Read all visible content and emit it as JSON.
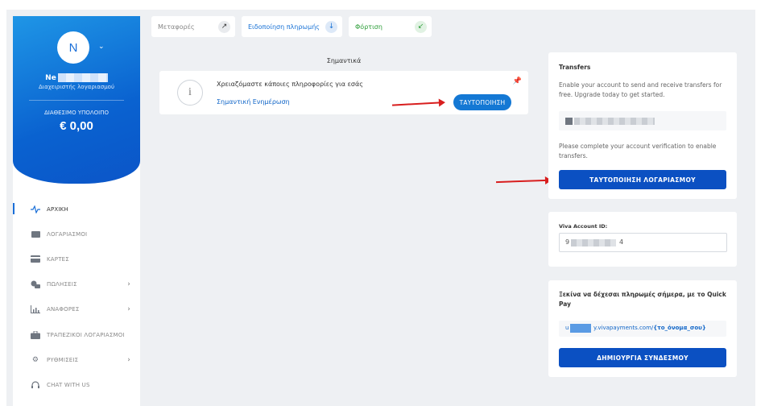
{
  "sidebar": {
    "avatar_initial": "N",
    "user_name": "Ne",
    "user_role": "Διαχειριστής λογαριασμού",
    "balance_label": "ΔΙΑΘΕΣΙΜΟ ΥΠΟΛΟΙΠΟ",
    "balance_value": "€ 0,00",
    "items": [
      {
        "label": "ΑΡΧΙΚΗ",
        "icon": "activity-icon",
        "active": true
      },
      {
        "label": "ΛΟΓΑΡΙΑΣΜΟΙ",
        "icon": "wallet-icon"
      },
      {
        "label": "ΚΑΡΤΕΣ",
        "icon": "card-icon"
      },
      {
        "label": "ΠΩΛΗΣΕΙΣ",
        "icon": "sales-icon",
        "has_submenu": true
      },
      {
        "label": "ΑΝΑΦΟΡΕΣ",
        "icon": "chart-icon",
        "has_submenu": true
      },
      {
        "label": "ΤΡΑΠΕΖΙΚΟΙ ΛΟΓΑΡΙΑΣΜΟΙ",
        "icon": "briefcase-icon"
      },
      {
        "label": "ΡΥΘΜΙΣΕΙΣ",
        "icon": "gear-icon",
        "has_submenu": true
      },
      {
        "label": "CHAT WITH US",
        "icon": "headset-icon"
      }
    ]
  },
  "tabs": [
    {
      "label": "Μεταφορές",
      "icon": "arrow-up-right-icon",
      "color": "#888888"
    },
    {
      "label": "Ειδοποίηση πληρωμής",
      "icon": "arrow-down-icon",
      "color": "#1a73d6"
    },
    {
      "label": "Φόρτιση",
      "icon": "arrow-down-left-icon",
      "color": "#2e9e3a"
    }
  ],
  "notice": {
    "section_title": "Σημαντικά",
    "message": "Χρειαζόμαστε κάποιες πληροφορίες για εσάς",
    "link_label": "Σημαντική Ενημέρωση",
    "button_label": "ΤΑΥΤΟΠΟΙΗΣΗ"
  },
  "transfers": {
    "title": "Transfers",
    "description": "Enable your account to send and receive transfers for free. Upgrade today to get started.",
    "verify_text": "Please complete your account verification to enable transfers.",
    "button_label": "ΤΑΥΤΟΠΟΙΗΣΗ ΛΟΓΑΡΙΑΣΜΟΥ"
  },
  "account_id": {
    "label": "Viva Account ID:",
    "value_start": "9",
    "value_end": "4"
  },
  "quickpay": {
    "title": "Ξεκίνα να δέχεσαι πληρωμές σήμερα, με το Quick Pay",
    "url_prefix": "u",
    "url_rest": "y.vivapayments.com/",
    "url_placeholder": "{το_όνομα_σου}",
    "button_label": "ΔΗΜΙΟΥΡΓΙΑ ΣΥΝΔΕΣΜΟΥ"
  },
  "colors": {
    "primary": "#0b50c2",
    "accent": "#1478d4",
    "annotation_arrow": "#d81e1e"
  }
}
